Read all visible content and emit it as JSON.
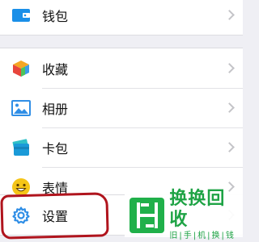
{
  "wallet_group": {
    "items": [
      {
        "label": "钱包",
        "icon": "wallet-icon"
      }
    ]
  },
  "main_group": {
    "items": [
      {
        "label": "收藏",
        "icon": "favorites-cube-icon"
      },
      {
        "label": "相册",
        "icon": "album-picture-icon"
      },
      {
        "label": "卡包",
        "icon": "card-wallet-icon"
      },
      {
        "label": "表情",
        "icon": "smiley-face-icon"
      }
    ]
  },
  "settings_group": {
    "items": [
      {
        "label": "设置",
        "icon": "gear-icon"
      }
    ]
  },
  "watermark": {
    "title": "换换回收",
    "subtitle": "旧|手|机|换|钱"
  },
  "colors": {
    "background": "#efeff4",
    "annotation_red": "#b0141d",
    "watermark_green": "#20b04a",
    "wallet_blue": "#1a8fe8",
    "album_blue": "#2f8ee6",
    "smiley_yellow": "#f5c518"
  }
}
